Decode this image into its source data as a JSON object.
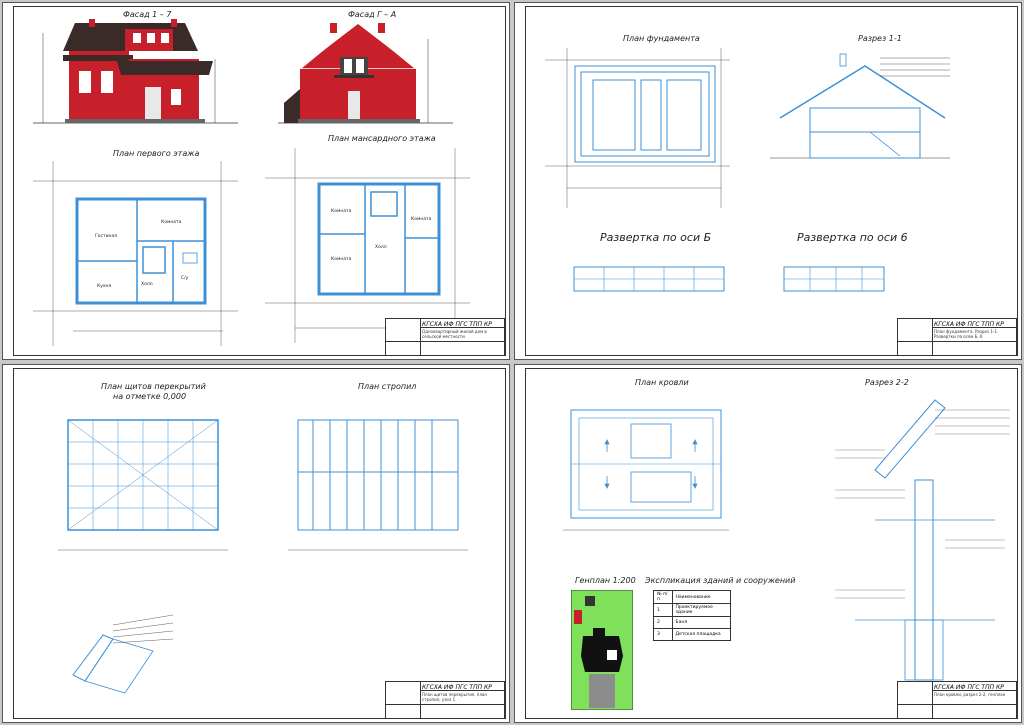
{
  "sheets": [
    {
      "id": "sheet1",
      "titles": {
        "facade_1_7": "Фасад 1 – 7",
        "facade_g_a": "Фасад Г – А",
        "plan_first": "План первого этажа",
        "plan_attic": "План мансардного этажа"
      },
      "rooms_first": {
        "living": "Гостиная",
        "kitchen": "Кухня",
        "room": "Комната",
        "hall": "Холл",
        "bath": "С/у"
      },
      "rooms_attic": {
        "room1": "Комната",
        "room2": "Комната",
        "room3": "Комната",
        "hall": "Холл"
      },
      "stamp": {
        "code": "КГСХА ИФ ПГС ТПП КР",
        "desc": "Одноквартирный жилой дом в сельской местности"
      }
    },
    {
      "id": "sheet2",
      "titles": {
        "foundation": "План фундамента",
        "section_1_1": "Разрез 1-1",
        "unfold_b": "Развертка по оси Б",
        "unfold_6": "Развертка по оси 6"
      },
      "stamp": {
        "code": "КГСХА ИФ ПГС ТПП КР",
        "desc": "План фундамента. Разрез 1-1. Развертки по осям Б, 6"
      }
    },
    {
      "id": "sheet3",
      "titles": {
        "floor_panels": "План щитов перекрытий",
        "floor_panels_2": "на отметке 0,000",
        "rafters": "План стропил"
      },
      "stamp": {
        "code": "КГСХА ИФ ПГС ТПП КР",
        "desc": "План щитов перекрытия, план стропил, узел 1"
      }
    },
    {
      "id": "sheet4",
      "titles": {
        "roof_plan": "План кровли",
        "section_2_2": "Разрез 2-2",
        "genplan": "Генплан 1:200",
        "explication": "Экспликация зданий и сооружений"
      },
      "explication": {
        "headers": [
          "№ п/п",
          "Наименование"
        ],
        "rows": [
          [
            "1",
            "Проектируемое здание"
          ],
          [
            "2",
            "Баня"
          ],
          [
            "3",
            "Детская площадка"
          ]
        ]
      },
      "stamp": {
        "code": "КГСХА ИФ ПГС ТПП КР",
        "desc": "План кровли, разрез 2-2, генплан"
      }
    }
  ],
  "colors": {
    "wall_red": "#c8202a",
    "roof_dark": "#3a2b28",
    "line_blue": "#3d8fd6",
    "green": "#7fe05a"
  }
}
